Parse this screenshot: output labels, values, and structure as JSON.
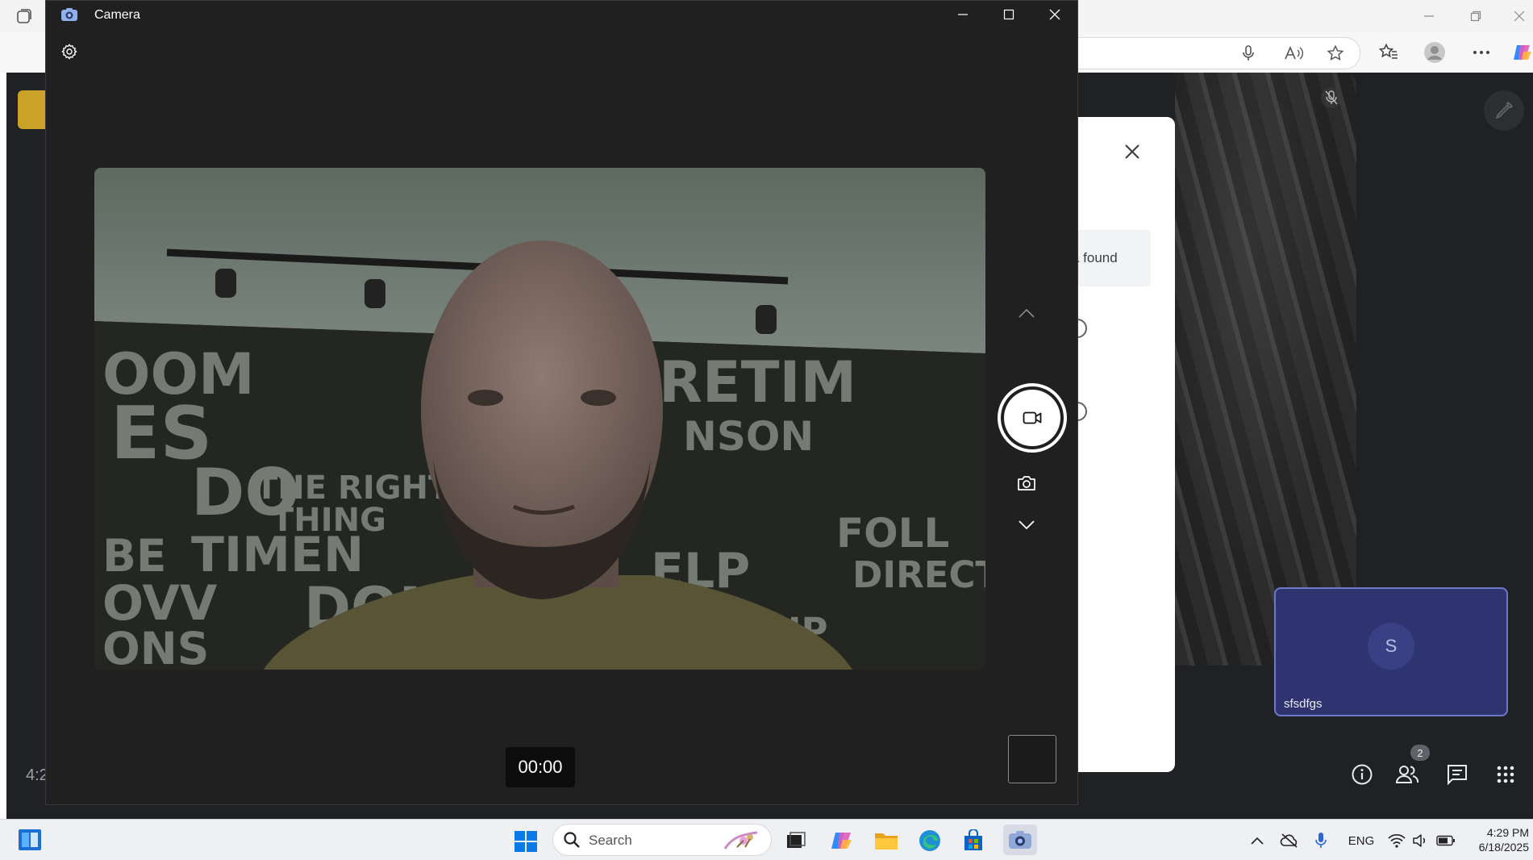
{
  "camera_window": {
    "title": "Camera",
    "timer": "00:00"
  },
  "meet": {
    "clock_partial": "4:2",
    "dialog_banner_text": "a found",
    "self_tile_name": "sfsdfgs",
    "self_tile_avatar_letter": "S",
    "people_count": "2"
  },
  "taskbar": {
    "search_placeholder": "Search",
    "language": "ENG",
    "time": "4:29 PM",
    "date": "6/18/2025"
  },
  "colors": {
    "record_badge": "#c9a227",
    "self_tile_bg": "#2f3470",
    "self_tile_border": "#6f77c9",
    "camera_bg": "#202020"
  }
}
